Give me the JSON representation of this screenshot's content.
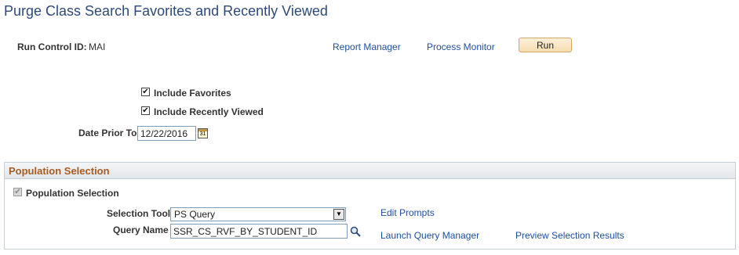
{
  "page": {
    "title": "Purge Class Search Favorites and Recently Viewed"
  },
  "run_control": {
    "label": "Run Control ID:",
    "value": "MAI",
    "report_manager": "Report Manager",
    "process_monitor": "Process Monitor",
    "run_button": "Run"
  },
  "options": {
    "include_favorites": {
      "label": "Include Favorites",
      "checked": true
    },
    "include_recently_viewed": {
      "label": "Include Recently Viewed",
      "checked": true
    },
    "date_prior_to": {
      "label": "Date Prior To",
      "value": "12/22/2016"
    }
  },
  "population": {
    "section_title": "Population Selection",
    "checkbox_label": "Population Selection",
    "checkbox_checked": true,
    "selection_tool_label": "Selection Tool",
    "selection_tool_value": "PS Query",
    "query_name_label": "Query Name",
    "query_name_value": "SSR_CS_RVF_BY_STUDENT_ID",
    "edit_prompts": "Edit Prompts",
    "launch_query_manager": "Launch Query Manager",
    "preview_selection_results": "Preview Selection Results"
  },
  "icons": {
    "calendar": "calendar-icon",
    "lookup": "magnifier-lookup-icon",
    "dropdown": "chevron-down-icon"
  },
  "colors": {
    "title": "#2e4a78",
    "link": "#1f4fa0",
    "section_title": "#a85c22",
    "run_button_bg": "#f6dcb0"
  }
}
